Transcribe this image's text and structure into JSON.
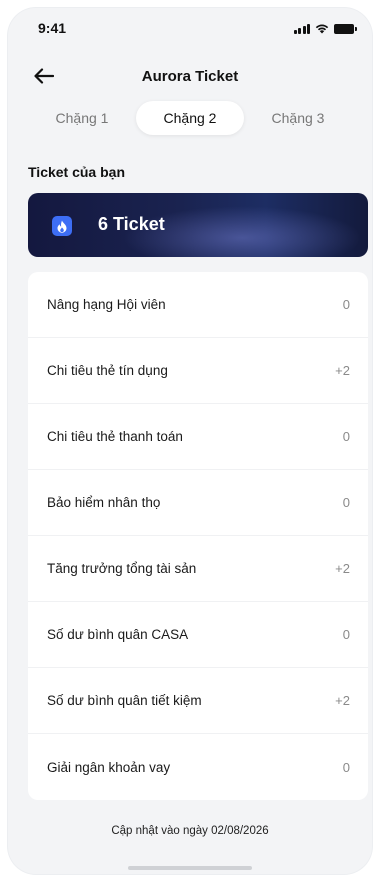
{
  "status_bar": {
    "time": "9:41"
  },
  "header": {
    "title": "Aurora Ticket"
  },
  "tabs": [
    {
      "label": "Chặng 1",
      "active": false
    },
    {
      "label": "Chặng 2",
      "active": true
    },
    {
      "label": "Chặng 3",
      "active": false
    }
  ],
  "section": {
    "title": "Ticket của bạn"
  },
  "banner": {
    "count_text": "6 Ticket",
    "icon": "flame-icon"
  },
  "items": [
    {
      "label": "Nâng hạng Hội viên",
      "value": "0"
    },
    {
      "label": "Chi tiêu thẻ tín dụng",
      "value": "+2"
    },
    {
      "label": "Chi tiêu thẻ thanh toán",
      "value": "0"
    },
    {
      "label": "Bảo hiểm nhân thọ",
      "value": "0"
    },
    {
      "label": "Tăng trưởng tổng tài sản",
      "value": "+2"
    },
    {
      "label": "Số dư bình quân CASA",
      "value": "0"
    },
    {
      "label": "Số dư bình quân tiết kiệm",
      "value": "+2"
    },
    {
      "label": "Giải ngân khoản vay",
      "value": "0"
    }
  ],
  "footer": {
    "updated_text": "Cập nhật vào ngày 02/08/2026"
  },
  "colors": {
    "accent": "#3d6ef5",
    "banner_dark": "#14183f",
    "background": "#f3f4f6"
  }
}
